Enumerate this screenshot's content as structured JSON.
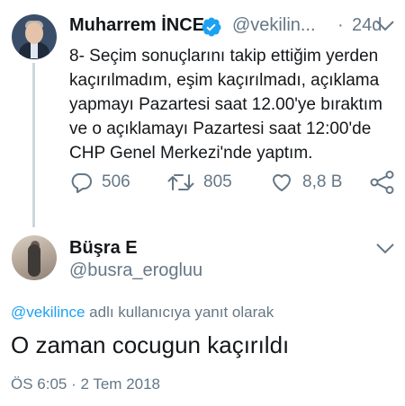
{
  "original_tweet": {
    "author_name": "Muharrem İNCE",
    "handle": "@vekilin...",
    "separator": "·",
    "age": "24d",
    "text_lines": [
      "8- Seçim sonuçlarını takip ettiğim yerden",
      "kaçırılmadım, eşim kaçırılmadı, açıklama",
      "yapmayı Pazartesi saat 12.00'ye bıraktım",
      "ve o açıklamayı Pazartesi saat 12:00'de",
      "CHP Genel Merkezi'nde yaptım."
    ],
    "replies": "506",
    "retweets": "805",
    "likes": "8,8 B",
    "verified": true
  },
  "reply_tweet": {
    "author_name": "Büşra E",
    "handle": "@busra_erogluu",
    "replying_to_mention": "@vekilince",
    "replying_to_suffix": " adlı kullanıcıya yanıt olarak",
    "text": "O zaman cocugun kaçırıldı",
    "timestamp": "ÖS 6:05 · 2 Tem 2018"
  },
  "icons": [
    "reply-icon",
    "retweet-icon",
    "like-icon",
    "share-icon",
    "verified-badge-icon",
    "chevron-down-icon"
  ],
  "colors": {
    "text": "#14171a",
    "secondary": "#657786",
    "link": "#1da1f2",
    "thread_line": "#ccd6dd",
    "verified": "#1da1f2"
  }
}
